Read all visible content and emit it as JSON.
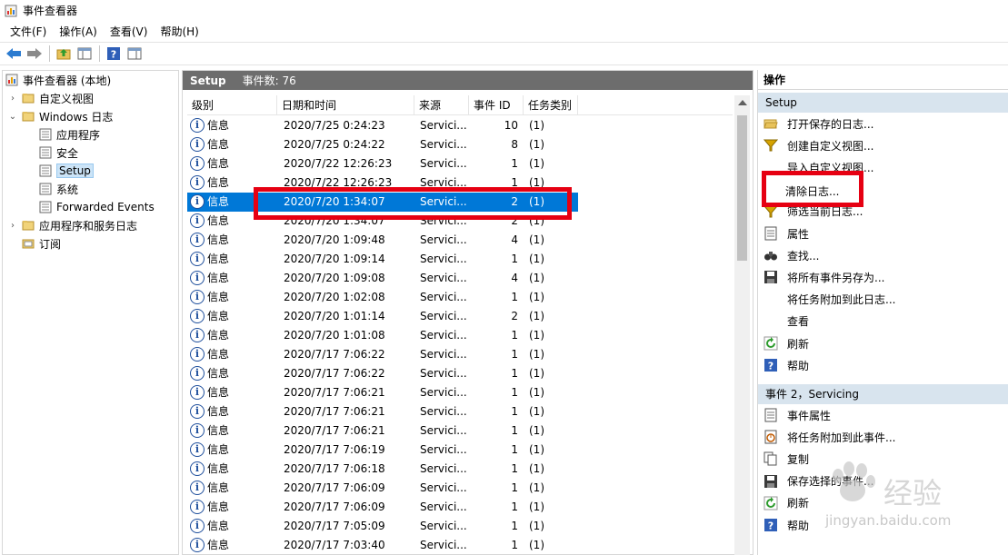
{
  "window": {
    "title": "事件查看器"
  },
  "menu": [
    "文件(F)",
    "操作(A)",
    "查看(V)",
    "帮助(H)"
  ],
  "toolbar": {
    "buttons": [
      "back-icon",
      "forward-icon",
      "folder-up-icon",
      "console-tree-icon",
      "help-icon",
      "action-pane-icon"
    ]
  },
  "tree": {
    "items": [
      {
        "label": "事件查看器 (本地)",
        "level": 0,
        "expander": "",
        "icon": "event-viewer-icon"
      },
      {
        "label": "自定义视图",
        "level": 1,
        "expander": "›",
        "icon": "folder-icon"
      },
      {
        "label": "Windows 日志",
        "level": 1,
        "expander": "⌄",
        "icon": "folder-icon"
      },
      {
        "label": "应用程序",
        "level": 2,
        "expander": "",
        "icon": "log-icon"
      },
      {
        "label": "安全",
        "level": 2,
        "expander": "",
        "icon": "log-icon"
      },
      {
        "label": "Setup",
        "level": 2,
        "expander": "",
        "icon": "log-icon",
        "selected": true
      },
      {
        "label": "系统",
        "level": 2,
        "expander": "",
        "icon": "log-icon"
      },
      {
        "label": "Forwarded Events",
        "level": 2,
        "expander": "",
        "icon": "log-icon"
      },
      {
        "label": "应用程序和服务日志",
        "level": 1,
        "expander": "›",
        "icon": "folder-icon"
      },
      {
        "label": "订阅",
        "level": 1,
        "expander": "",
        "icon": "subscription-icon"
      }
    ]
  },
  "main": {
    "title": "Setup",
    "event_count": "事件数: 76",
    "columns": [
      "级别",
      "日期和时间",
      "来源",
      "事件 ID",
      "任务类别"
    ],
    "rows": [
      {
        "level": "信息",
        "datetime": "2020/7/25 0:24:23",
        "source": "Servici...",
        "id": "10",
        "task": "(1)"
      },
      {
        "level": "信息",
        "datetime": "2020/7/25 0:24:22",
        "source": "Servici...",
        "id": "8",
        "task": "(1)"
      },
      {
        "level": "信息",
        "datetime": "2020/7/22 12:26:23",
        "source": "Servici...",
        "id": "1",
        "task": "(1)"
      },
      {
        "level": "信息",
        "datetime": "2020/7/22 12:26:23",
        "source": "Servici...",
        "id": "1",
        "task": "(1)"
      },
      {
        "level": "信息",
        "datetime": "2020/7/20 1:34:07",
        "source": "Servici...",
        "id": "2",
        "task": "(1)",
        "selected": true
      },
      {
        "level": "信息",
        "datetime": "2020/7/20 1:34:07",
        "source": "Servici...",
        "id": "2",
        "task": "(1)"
      },
      {
        "level": "信息",
        "datetime": "2020/7/20 1:09:48",
        "source": "Servici...",
        "id": "4",
        "task": "(1)"
      },
      {
        "level": "信息",
        "datetime": "2020/7/20 1:09:14",
        "source": "Servici...",
        "id": "1",
        "task": "(1)"
      },
      {
        "level": "信息",
        "datetime": "2020/7/20 1:09:08",
        "source": "Servici...",
        "id": "4",
        "task": "(1)"
      },
      {
        "level": "信息",
        "datetime": "2020/7/20 1:02:08",
        "source": "Servici...",
        "id": "1",
        "task": "(1)"
      },
      {
        "level": "信息",
        "datetime": "2020/7/20 1:01:14",
        "source": "Servici...",
        "id": "2",
        "task": "(1)"
      },
      {
        "level": "信息",
        "datetime": "2020/7/20 1:01:08",
        "source": "Servici...",
        "id": "1",
        "task": "(1)"
      },
      {
        "level": "信息",
        "datetime": "2020/7/17 7:06:22",
        "source": "Servici...",
        "id": "1",
        "task": "(1)"
      },
      {
        "level": "信息",
        "datetime": "2020/7/17 7:06:22",
        "source": "Servici...",
        "id": "1",
        "task": "(1)"
      },
      {
        "level": "信息",
        "datetime": "2020/7/17 7:06:21",
        "source": "Servici...",
        "id": "1",
        "task": "(1)"
      },
      {
        "level": "信息",
        "datetime": "2020/7/17 7:06:21",
        "source": "Servici...",
        "id": "1",
        "task": "(1)"
      },
      {
        "level": "信息",
        "datetime": "2020/7/17 7:06:21",
        "source": "Servici...",
        "id": "1",
        "task": "(1)"
      },
      {
        "level": "信息",
        "datetime": "2020/7/17 7:06:19",
        "source": "Servici...",
        "id": "1",
        "task": "(1)"
      },
      {
        "level": "信息",
        "datetime": "2020/7/17 7:06:18",
        "source": "Servici...",
        "id": "1",
        "task": "(1)"
      },
      {
        "level": "信息",
        "datetime": "2020/7/17 7:06:09",
        "source": "Servici...",
        "id": "1",
        "task": "(1)"
      },
      {
        "level": "信息",
        "datetime": "2020/7/17 7:06:09",
        "source": "Servici...",
        "id": "1",
        "task": "(1)"
      },
      {
        "level": "信息",
        "datetime": "2020/7/17 7:05:09",
        "source": "Servici...",
        "id": "1",
        "task": "(1)"
      },
      {
        "level": "信息",
        "datetime": "2020/7/17 7:03:40",
        "source": "Servici...",
        "id": "1",
        "task": "(1)"
      }
    ]
  },
  "actions": {
    "title": "操作",
    "section1": "Setup",
    "section1_items": [
      {
        "label": "打开保存的日志...",
        "icon": "open-folder-icon"
      },
      {
        "label": "创建自定义视图...",
        "icon": "filter-icon"
      },
      {
        "label": "导入自定义视图...",
        "icon": "blank"
      },
      {
        "label": "清除日志...",
        "icon": "blank"
      },
      {
        "label": "筛选当前日志...",
        "icon": "filter-icon"
      },
      {
        "label": "属性",
        "icon": "properties-icon"
      },
      {
        "label": "查找...",
        "icon": "binoculars-icon"
      },
      {
        "label": "将所有事件另存为...",
        "icon": "save-icon"
      },
      {
        "label": "将任务附加到此日志...",
        "icon": "blank"
      },
      {
        "label": "查看",
        "icon": "blank"
      },
      {
        "label": "刷新",
        "icon": "refresh-icon"
      },
      {
        "label": "帮助",
        "icon": "help-icon"
      }
    ],
    "section2": "事件 2，Servicing",
    "section2_items": [
      {
        "label": "事件属性",
        "icon": "properties-icon"
      },
      {
        "label": "将任务附加到此事件...",
        "icon": "task-icon"
      },
      {
        "label": "复制",
        "icon": "copy-icon"
      },
      {
        "label": "保存选择的事件...",
        "icon": "save-icon"
      },
      {
        "label": "刷新",
        "icon": "refresh-icon"
      },
      {
        "label": "帮助",
        "icon": "help-icon"
      }
    ]
  },
  "watermark": {
    "text": "经验",
    "url": "jingyan.baidu.com"
  },
  "colors": {
    "selection": "#0078d7",
    "highlight": "#e60012",
    "header_dark": "#6d6d6d",
    "section_bg": "#d8e4ee"
  }
}
